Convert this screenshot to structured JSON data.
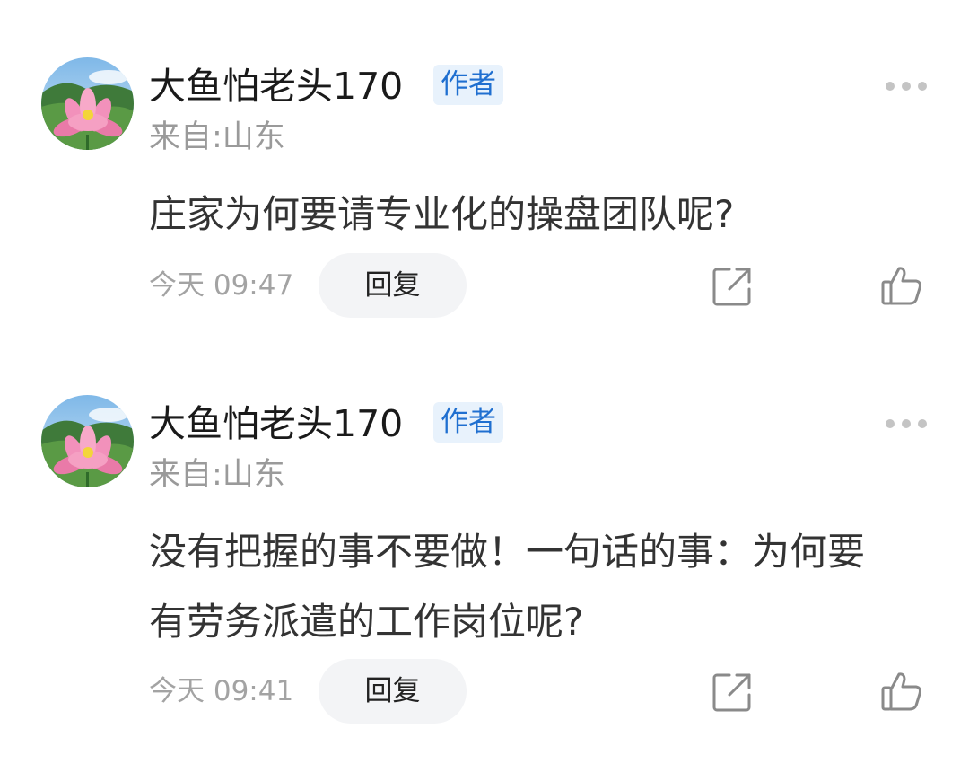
{
  "comments": [
    {
      "username": "大鱼怕老头170",
      "badge": "作者",
      "location": "来自:山东",
      "content": "庄家为何要请专业化的操盘团队呢?",
      "timestamp": "今天 09:47",
      "reply_label": "回复",
      "icons": {
        "more": "more-dots-icon",
        "share": "share-icon",
        "like": "thumbs-up-icon"
      }
    },
    {
      "username": "大鱼怕老头170",
      "badge": "作者",
      "location": "来自:山东",
      "content": "没有把握的事不要做！一句话的事：为何要有劳务派遣的工作岗位呢?",
      "timestamp": "今天 09:41",
      "reply_label": "回复",
      "icons": {
        "more": "more-dots-icon",
        "share": "share-icon",
        "like": "thumbs-up-icon"
      }
    }
  ],
  "colors": {
    "badge_bg": "#e8f2fc",
    "badge_text": "#1f6fd0",
    "muted_text": "#9a9a9a",
    "body_text": "#333333"
  }
}
